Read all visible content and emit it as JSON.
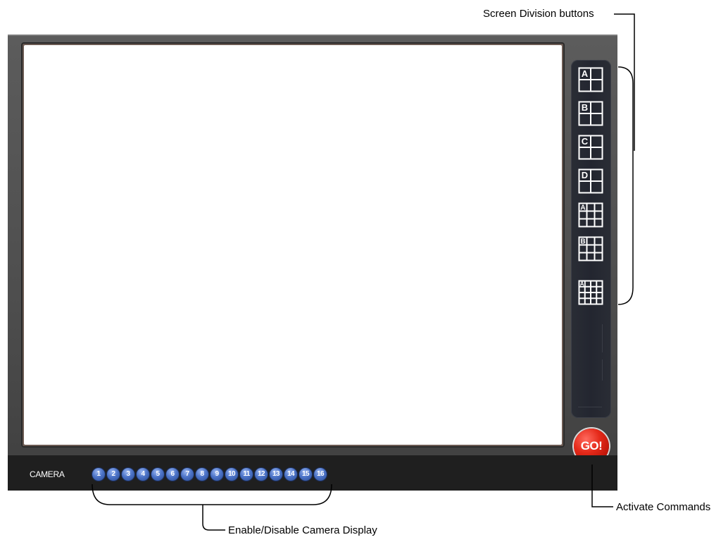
{
  "annotations": {
    "screen_division": "Screen Division buttons",
    "activate_commands": "Activate Commands",
    "camera_display": "Enable/Disable Camera Display"
  },
  "division_buttons": [
    {
      "letter": "A",
      "grid": "2x2"
    },
    {
      "letter": "B",
      "grid": "2x2"
    },
    {
      "letter": "C",
      "grid": "2x2"
    },
    {
      "letter": "D",
      "grid": "2x2"
    },
    {
      "letter": "A",
      "grid": "3x3"
    },
    {
      "letter": "B",
      "grid": "3x3"
    },
    {
      "letter": "A",
      "grid": "4x4"
    }
  ],
  "go_button": {
    "label": "GO!"
  },
  "camera_bar": {
    "label": "CAMERA",
    "cameras": [
      "1",
      "2",
      "3",
      "4",
      "5",
      "6",
      "7",
      "8",
      "9",
      "10",
      "11",
      "12",
      "13",
      "14",
      "15",
      "16"
    ]
  },
  "colors": {
    "panel_gray": "#4d4d4d",
    "bottom_bar": "#1f1f1f",
    "division_panel": "#252831",
    "go_red": "#e52a1a",
    "camera_blue": "#4d74c8"
  }
}
